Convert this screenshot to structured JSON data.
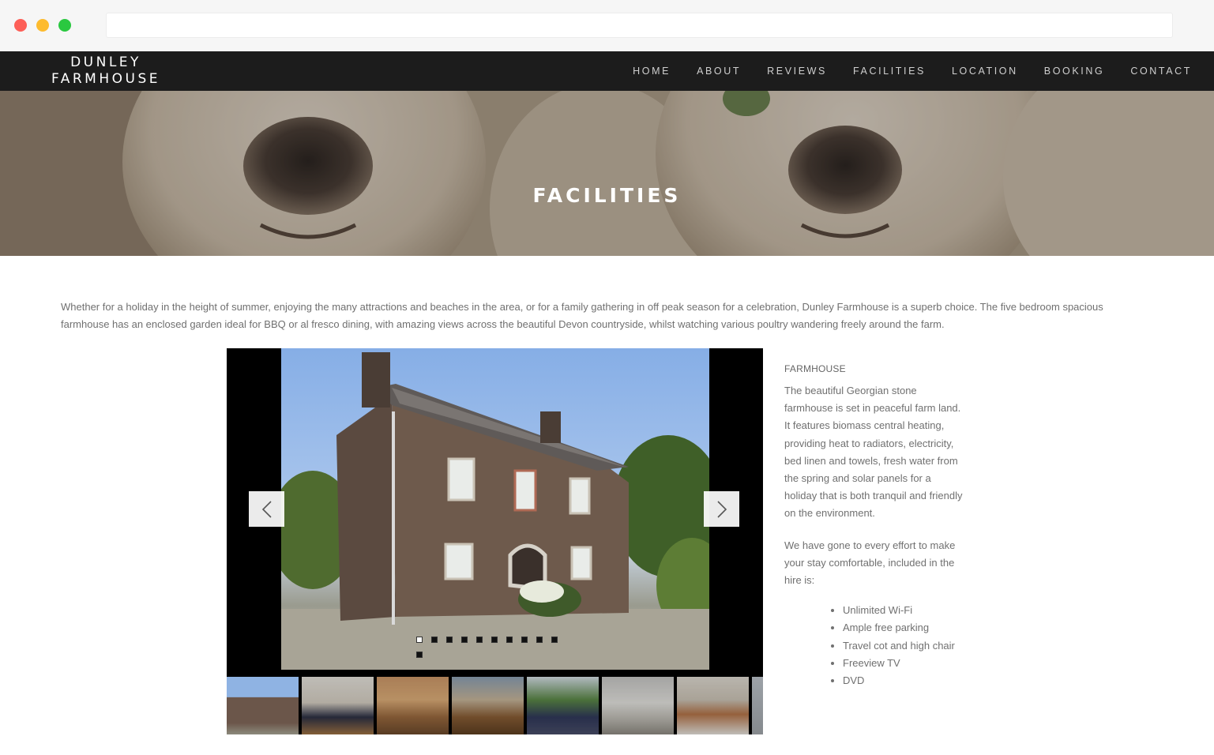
{
  "site": {
    "logo_line1": "DUNLEY",
    "logo_line2": "FARMHOUSE"
  },
  "nav": {
    "items": [
      "HOME",
      "ABOUT",
      "REVIEWS",
      "FACILITIES",
      "LOCATION",
      "BOOKING",
      "CONTACT"
    ]
  },
  "hero": {
    "title": "FACILITIES"
  },
  "intro": {
    "text": "Whether for a holiday in the height of summer, enjoying the many attractions and beaches in the area, or for a family gathering in off peak season for a celebration, Dunley Farmhouse is a superb choice. The five bedroom spacious farmhouse has an enclosed garden ideal for BBQ or al fresco dining, with amazing views across the beautiful Devon countryside, whilst watching various poultry wandering freely around the farm."
  },
  "slider": {
    "prev_icon": "chevron-left-icon",
    "next_icon": "chevron-right-icon",
    "slide_count": 11,
    "active_index": 0
  },
  "farmhouse": {
    "heading": "FARMHOUSE",
    "para1": "The beautiful Georgian stone farmhouse is set in peaceful farm land. It features biomass central heating, providing heat to radiators, electricity, bed linen and towels, fresh water from the spring and solar panels for a holiday that is both tranquil and friendly on the environment.",
    "para2": "We have gone to every effort to make your stay comfortable, included in the hire is:",
    "amenities": [
      "Unlimited Wi-Fi",
      "Ample free parking",
      "Travel cot and high chair",
      "Freeview TV",
      "DVD"
    ]
  },
  "colors": {
    "nav_bg": "#1c1c1c",
    "window_red": "#fd5f57",
    "window_yellow": "#fdbb2e",
    "window_green": "#2ac840"
  }
}
